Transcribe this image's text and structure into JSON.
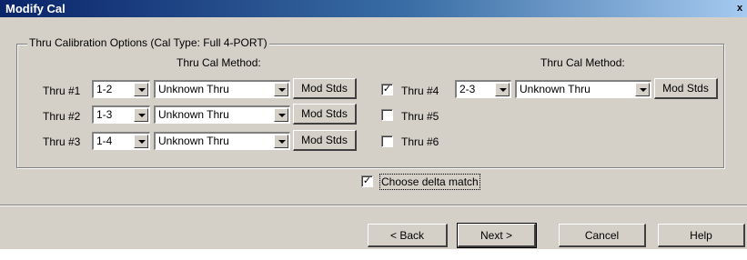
{
  "window": {
    "title": "Modify Cal",
    "close_glyph": "x"
  },
  "group": {
    "legend": "Thru Calibration Options (Cal Type: Full 4-PORT)"
  },
  "left_col": {
    "method_header": "Thru Cal Method:",
    "rows": [
      {
        "label": "Thru #1",
        "port": "1-2",
        "method": "Unknown Thru",
        "mod": "Mod Stds"
      },
      {
        "label": "Thru #2",
        "port": "1-3",
        "method": "Unknown Thru",
        "mod": "Mod Stds"
      },
      {
        "label": "Thru #3",
        "port": "1-4",
        "method": "Unknown Thru",
        "mod": "Mod Stds"
      }
    ]
  },
  "right_col": {
    "method_header": "Thru Cal Method:",
    "thru4": {
      "label": "Thru #4",
      "checked": true,
      "port": "2-3",
      "method": "Unknown Thru",
      "mod": "Mod Stds"
    },
    "thru5": {
      "label": "Thru #5",
      "checked": false
    },
    "thru6": {
      "label": "Thru #6",
      "checked": false
    }
  },
  "delta": {
    "label": "Choose delta match",
    "checked": true
  },
  "buttons": {
    "back": "< Back",
    "next": "Next >",
    "cancel": "Cancel",
    "help": "Help"
  },
  "icons": {
    "dropdown": "chevron-down-icon",
    "check": "check-icon"
  }
}
